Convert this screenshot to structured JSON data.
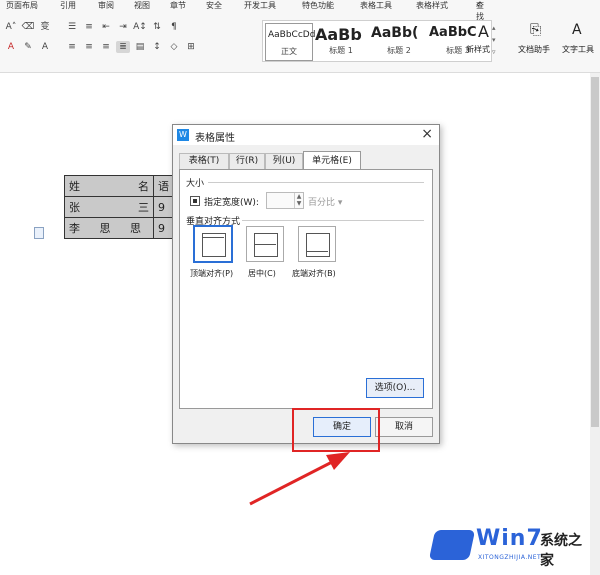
{
  "menubar": {
    "items": [
      "页面布局",
      "引用",
      "审阅",
      "视图",
      "章节",
      "安全",
      "开发工具",
      "特色功能",
      "表格工具",
      "表格样式"
    ],
    "search_label": "查找"
  },
  "styles": {
    "cards": [
      {
        "sample": "AaBbCcDd",
        "name": "正文"
      },
      {
        "sample": "AaBb",
        "name": "标题 1"
      },
      {
        "sample": "AaBb(",
        "name": "标题 2"
      },
      {
        "sample": "AaBbC",
        "name": "标题 3"
      }
    ],
    "new_style": "新样式",
    "doc_helper": "文档助手",
    "text_tool": "文字工具"
  },
  "doc_table": {
    "rows": [
      [
        "姓",
        "名",
        "语"
      ],
      [
        "张",
        "三",
        "9"
      ],
      [
        "李",
        "思 思",
        "9"
      ]
    ]
  },
  "dialog": {
    "title": "表格属性",
    "tabs": [
      "表格(T)",
      "行(R)",
      "列(U)",
      "单元格(E)"
    ],
    "active_tab": 3,
    "size_group": "大小",
    "specify_width_label": "指定宽度(W):",
    "width_value": "",
    "unit_label": "百分比",
    "valign_group": "垂直对齐方式",
    "valign_options": [
      "顶端对齐(P)",
      "居中(C)",
      "底端对齐(B)"
    ],
    "options_button": "选项(O)...",
    "ok_button": "确定",
    "cancel_button": "取消"
  },
  "watermark": {
    "brand": "Win7",
    "cn_text": "系统之家",
    "url": "XITONGZHIJIA.NET"
  },
  "colors": {
    "accent": "#2a6fd6",
    "highlight": "#e02525",
    "brand": "#2b63d8"
  }
}
